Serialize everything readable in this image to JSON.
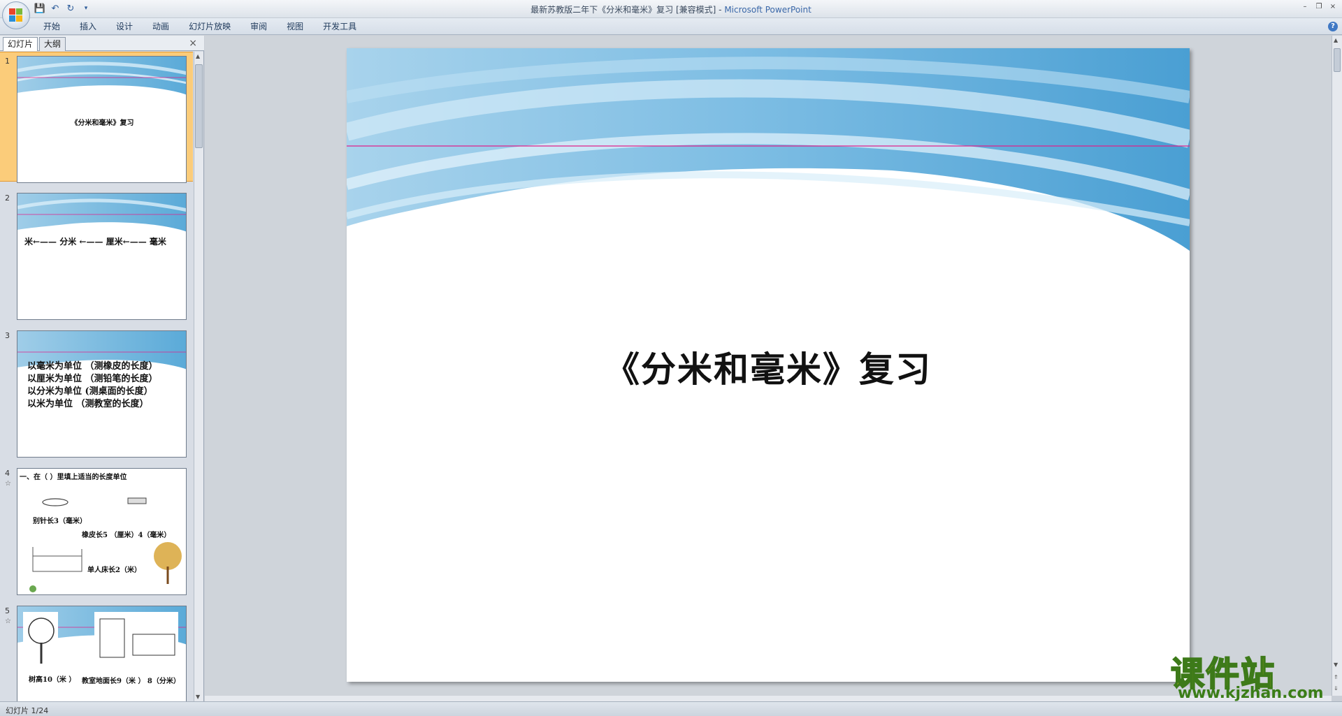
{
  "window": {
    "title": "最新苏教版二年下《分米和毫米》复习 [兼容模式] - ",
    "app_name": "Microsoft PowerPoint",
    "controls": [
      "–",
      "❐",
      "×"
    ]
  },
  "quick_access": {
    "save_icon": "save-icon",
    "undo_icon": "undo-icon",
    "redo_icon": "redo-icon",
    "customize_icon": "dropdown-icon"
  },
  "ribbon": {
    "tabs": [
      "开始",
      "插入",
      "设计",
      "动画",
      "幻灯片放映",
      "审阅",
      "视图",
      "开发工具"
    ],
    "help": "?"
  },
  "left_pane": {
    "tab_slides": "幻灯片",
    "tab_outline": "大纲",
    "close": "×"
  },
  "thumbnails": [
    {
      "num": "1",
      "text": "《分米和毫米》复习"
    },
    {
      "num": "2",
      "text": "米←—— 分米 ←—— 厘米←—— 毫米"
    },
    {
      "num": "3",
      "lines": [
        "以毫米为单位 （测橡皮的长度）",
        "以厘米为单位 （测铅笔的长度）",
        "以分米为单位 (测桌面的长度）",
        "以米为单位 （测教室的长度）"
      ]
    },
    {
      "num": "4",
      "header": "一、在（ ）里填上适当的长度单位",
      "items": [
        "别针长3（毫米）",
        "橡皮长5 （厘米）4（毫米）",
        "单人床长2（米）"
      ]
    },
    {
      "num": "5",
      "items": [
        "树高10（米 ）",
        "教室地面长9（米 ） 8（分米）"
      ]
    }
  ],
  "slide": {
    "title": "《分米和毫米》复习"
  },
  "watermark": {
    "title": "课件站",
    "url": "www.kjzhan.com"
  },
  "status": {
    "text": "幻灯片 1/24"
  }
}
